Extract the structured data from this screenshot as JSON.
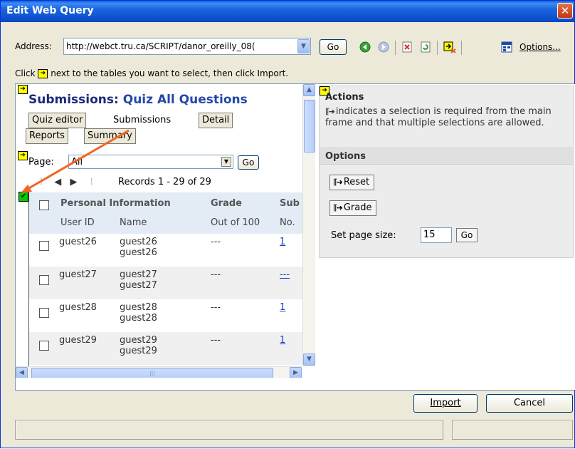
{
  "window": {
    "title": "Edit Web Query"
  },
  "toolbar": {
    "address_label": "Address:",
    "address_value": "http://webct.tru.ca/SCRIPT/danor_oreilly_08(",
    "go_label": "Go",
    "options_label": "Options..."
  },
  "hint": {
    "before": "Click",
    "after": "next to the tables you want to select, then click Import."
  },
  "left": {
    "title_main": "Submissions: ",
    "title_quiz": "Quiz All Questions",
    "tabs": [
      "Quiz editor",
      "Submissions",
      "Detail",
      "Reports",
      "Summary"
    ],
    "page_label": "Page:",
    "page_value": "All",
    "page_go": "Go",
    "records": "Records 1 - 29 of 29",
    "headers": {
      "personal": "Personal Information",
      "grade": "Grade",
      "sub": "Sub",
      "user_id": "User ID",
      "name": "Name",
      "out_of": "Out of 100",
      "no": "No."
    },
    "rows": [
      {
        "user": "guest26",
        "name1": "guest26",
        "name2": "guest26",
        "grade": "---",
        "no": "1"
      },
      {
        "user": "guest27",
        "name1": "guest27",
        "name2": "guest27",
        "grade": "---",
        "no": "---"
      },
      {
        "user": "guest28",
        "name1": "guest28",
        "name2": "guest28",
        "grade": "---",
        "no": "1"
      },
      {
        "user": "guest29",
        "name1": "guest29",
        "name2": "guest29",
        "grade": "---",
        "no": "1"
      }
    ]
  },
  "right": {
    "actions_title": "Actions",
    "actions_desc": "indicates a selection is required from the main frame and that multiple selections are allowed.",
    "options_title": "Options",
    "reset_label": "Reset",
    "grade_label": "Grade",
    "page_size_label": "Set page size:",
    "page_size_value": "15",
    "page_size_go": "Go"
  },
  "footer": {
    "import_label": "Import",
    "cancel_label": "Cancel"
  },
  "colors": {
    "titlebar": "#0a5fd8",
    "accent_arrow": "#f26522",
    "select_marker": "#ffff00",
    "selected_marker": "#00cc00"
  }
}
